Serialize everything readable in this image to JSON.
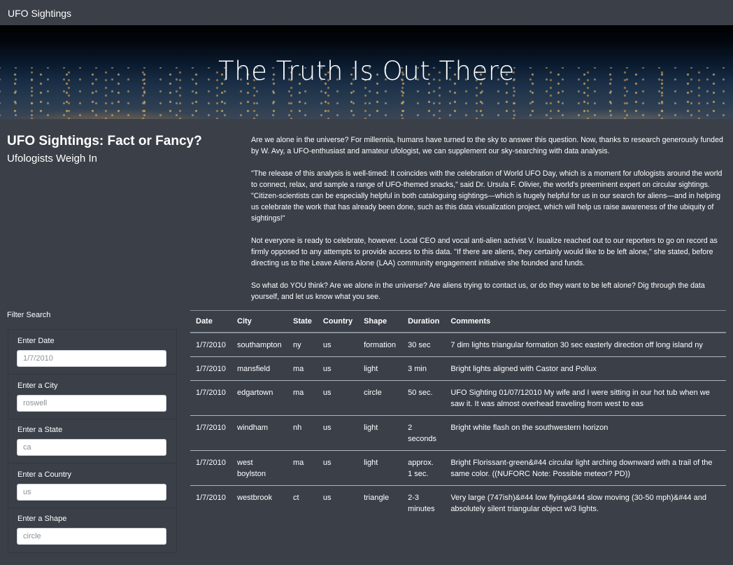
{
  "navbar": {
    "brand": "UFO Sightings"
  },
  "hero": {
    "title": "The Truth Is Out There"
  },
  "intro": {
    "heading": "UFO Sightings: Fact or Fancy?",
    "subheading": "Ufologists Weigh In",
    "paragraphs": [
      "Are we alone in the universe? For millennia, humans have turned to the sky to answer this question. Now, thanks to research generously funded by W. Avy, a UFO-enthusiast and amateur ufologist, we can supplement our sky-searching with data analysis.",
      "\"The release of this analysis is well-timed: It coincides with the celebration of World UFO Day, which is a moment for ufologists around the world to connect, relax, and sample a range of UFO-themed snacks,\" said Dr. Ursula F. Olivier, the world's preeminent expert on circular sightings. \"Citizen-scientists can be especially helpful in both cataloguing sightings—which is hugely helpful for us in our search for aliens—and in helping us celebrate the work that has already been done, such as this data visualization project, which will help us raise awareness of the ubiquity of sightings!\"",
      "Not everyone is ready to celebrate, however. Local CEO and vocal anti-alien activist V. Isualize reached out to our reporters to go on record as firmly opposed to any attempts to provide access to this data. \"If there are aliens, they certainly would like to be left alone,\" she stated, before directing us to the Leave Aliens Alone (LAA) community engagement initiative she founded and funds.",
      "So what do YOU think? Are we alone in the universe? Are aliens trying to contact us, or do they want to be left alone? Dig through the data yourself, and let us know what you see."
    ]
  },
  "filters": {
    "title": "Filter Search",
    "fields": [
      {
        "label": "Enter Date",
        "placeholder": "1/7/2010"
      },
      {
        "label": "Enter a City",
        "placeholder": "roswell"
      },
      {
        "label": "Enter a State",
        "placeholder": "ca"
      },
      {
        "label": "Enter a Country",
        "placeholder": "us"
      },
      {
        "label": "Enter a Shape",
        "placeholder": "circle"
      }
    ]
  },
  "table": {
    "headers": [
      "Date",
      "City",
      "State",
      "Country",
      "Shape",
      "Duration",
      "Comments"
    ],
    "rows": [
      [
        "1/7/2010",
        "southampton",
        "ny",
        "us",
        "formation",
        "30 sec",
        "7 dim lights triangular formation 30 sec easterly direction off long island ny"
      ],
      [
        "1/7/2010",
        "mansfield",
        "ma",
        "us",
        "light",
        "3 min",
        "Bright lights aligned with Castor and Pollux"
      ],
      [
        "1/7/2010",
        "edgartown",
        "ma",
        "us",
        "circle",
        "50 sec.",
        "UFO Sighting 01/07/12010 My wife and I were sitting in our hot tub when we saw it. It was almost overhead traveling from west to eas"
      ],
      [
        "1/7/2010",
        "windham",
        "nh",
        "us",
        "light",
        "2 seconds",
        "Bright white flash on the southwestern horizon"
      ],
      [
        "1/7/2010",
        "west boylston",
        "ma",
        "us",
        "light",
        "approx. 1 sec.",
        "Bright Florissant-green&#44 circular light arching downward with a trail of the same color. ((NUFORC Note: Possible meteor? PD))"
      ],
      [
        "1/7/2010",
        "westbrook",
        "ct",
        "us",
        "triangle",
        "2-3 minutes",
        "Very large (747ish)&#44 low flying&#44 slow moving (30-50 mph)&#44 and absolutely silent triangular object w/3 lights."
      ]
    ]
  }
}
